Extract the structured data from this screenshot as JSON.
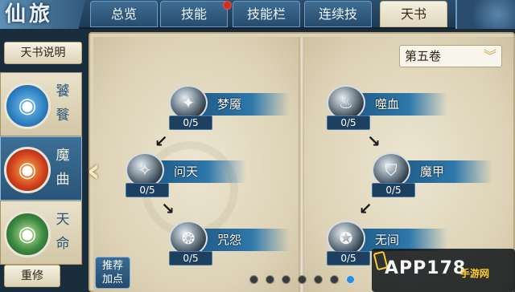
{
  "header": {
    "title": "仙旅",
    "tabs": [
      {
        "label": "总览",
        "active": false,
        "alert": false
      },
      {
        "label": "技能",
        "active": false,
        "alert": true
      },
      {
        "label": "技能栏",
        "active": false,
        "alert": false
      },
      {
        "label": "连续技",
        "active": false,
        "alert": false
      },
      {
        "label": "天书",
        "active": true,
        "alert": false
      }
    ]
  },
  "sidebar": {
    "info_button": "天书说明",
    "books": [
      {
        "name_1": "饕",
        "name_2": "餮",
        "emblem": "taotie-emblem",
        "color": "#2d7fc0",
        "active": false
      },
      {
        "name_1": "魔",
        "name_2": "曲",
        "emblem": "demon-emblem",
        "color": "#d4431f",
        "active": true
      },
      {
        "name_1": "天",
        "name_2": "命",
        "emblem": "fate-emblem",
        "color": "#3c8a43",
        "active": false
      }
    ],
    "reset_button": "重修"
  },
  "volume": {
    "label": "第五卷"
  },
  "skills": [
    {
      "name": "梦魇",
      "level": "0/5"
    },
    {
      "name": "问天",
      "level": "0/5"
    },
    {
      "name": "咒怨",
      "level": "0/5"
    },
    {
      "name": "噬血",
      "level": "0/5"
    },
    {
      "name": "魔甲",
      "level": "0/5"
    },
    {
      "name": "无间",
      "level": "0/5"
    }
  ],
  "recommend_button": {
    "line1": "推荐",
    "line2": "加点"
  },
  "pagination": {
    "total": 7,
    "current": 7
  },
  "watermark": {
    "text": "APP178",
    "sub": "手游网"
  },
  "colors": {
    "tab_active": "#f4efdf",
    "banner": "#2f78aa",
    "page": "#ece5d1"
  }
}
